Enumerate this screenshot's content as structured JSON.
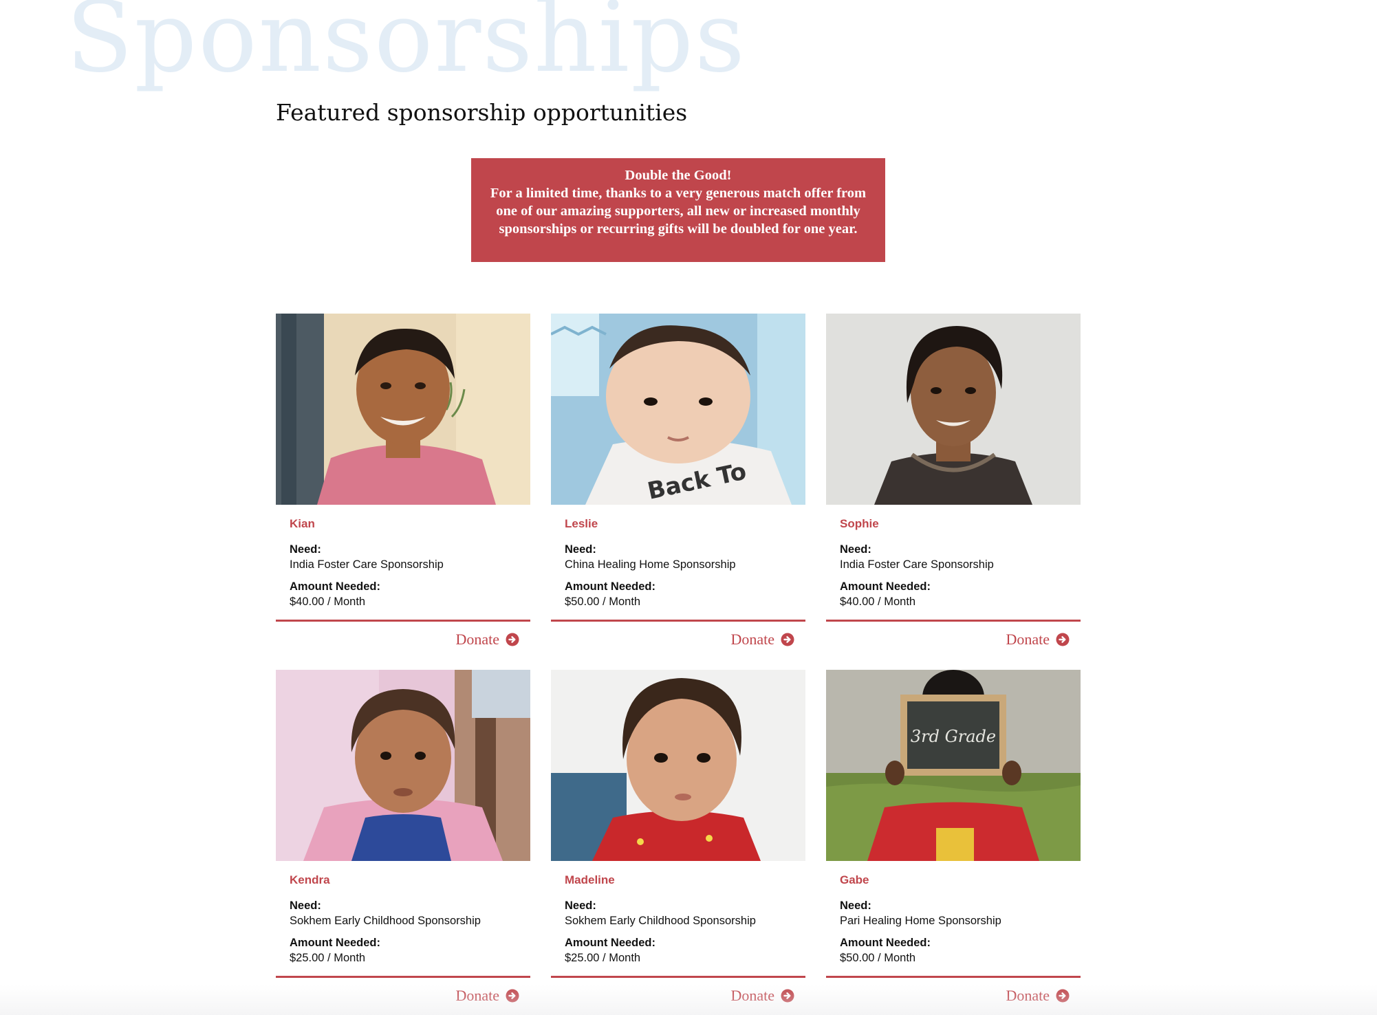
{
  "page": {
    "background_title": "Sponsorships",
    "section_title": "Featured sponsorship opportunities"
  },
  "promo": {
    "heading": "Double the Good!",
    "body": "For a limited time, thanks to a very generous match offer from one of our amazing supporters, all new or increased monthly sponsorships or recurring gifts will be doubled for one year."
  },
  "labels": {
    "need": "Need:",
    "amount": "Amount Needed:",
    "donate": "Donate"
  },
  "colors": {
    "accent": "#c0464c",
    "watermark": "#e3edf6"
  },
  "cards": [
    {
      "name": "Kian",
      "need": "India Foster Care Sponsorship",
      "amount": "$40.00 / Month",
      "donate_label": "Donate",
      "photo": "smiling boy in pink shirt"
    },
    {
      "name": "Leslie",
      "need": "China Healing Home Sponsorship",
      "amount": "$50.00 / Month",
      "donate_label": "Donate",
      "photo": "baby lying on blue blanket"
    },
    {
      "name": "Sophie",
      "need": "India Foster Care Sponsorship",
      "amount": "$40.00 / Month",
      "donate_label": "Donate",
      "photo": "smiling girl against white wall"
    },
    {
      "name": "Kendra",
      "need": "Sokhem Early Childhood Sponsorship",
      "amount": "$25.00 / Month",
      "donate_label": "Donate",
      "photo": "toddler in blue and pink clothes"
    },
    {
      "name": "Madeline",
      "need": "Sokhem Early Childhood Sponsorship",
      "amount": "$25.00 / Month",
      "donate_label": "Donate",
      "photo": "toddler in red top"
    },
    {
      "name": "Gabe",
      "need": "Pari Healing Home Sponsorship",
      "amount": "$50.00 / Month",
      "donate_label": "Donate",
      "photo": "child holding chalkboard",
      "chalkboard_text": "3rd Grade"
    }
  ]
}
